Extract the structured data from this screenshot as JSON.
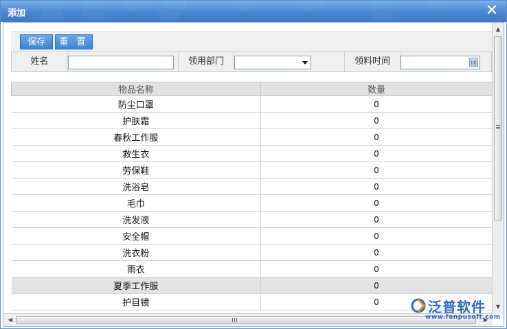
{
  "dialog": {
    "title": "添加",
    "close_glyph": "✕",
    "icons": {
      "close": "close-icon",
      "dropdown": "chevron-down-icon",
      "calendar": "calendar-icon"
    }
  },
  "toolbar": {
    "save_label": "保存",
    "reset_label": "重 置"
  },
  "form": {
    "name_label": "姓名",
    "name_value": "",
    "department_label": "领用部门",
    "department_value": "",
    "date_label": "领料时间",
    "date_value": ""
  },
  "table": {
    "columns": [
      "物品名称",
      "数量"
    ],
    "selected_index": 11,
    "rows": [
      {
        "name": "防尘口罩",
        "qty": "0"
      },
      {
        "name": "护肤霜",
        "qty": "0"
      },
      {
        "name": "春秋工作服",
        "qty": "0"
      },
      {
        "name": "救生衣",
        "qty": "0"
      },
      {
        "name": "劳保鞋",
        "qty": "0"
      },
      {
        "name": "洗浴皂",
        "qty": "0"
      },
      {
        "name": "毛巾",
        "qty": "0"
      },
      {
        "name": "洗发液",
        "qty": "0"
      },
      {
        "name": "安全帽",
        "qty": "0"
      },
      {
        "name": "洗衣粉",
        "qty": "0"
      },
      {
        "name": "雨衣",
        "qty": "0"
      },
      {
        "name": "夏季工作服",
        "qty": "0"
      },
      {
        "name": "护目镜",
        "qty": "0"
      }
    ]
  },
  "watermark": {
    "brand": "泛普软件",
    "url": "www.fanpusoft.com",
    "brand_color": "#2c6bbf"
  },
  "colors": {
    "titlebar": "#4a86cf",
    "button": "#3f83d4",
    "selected_row": "#e3e3e3"
  }
}
